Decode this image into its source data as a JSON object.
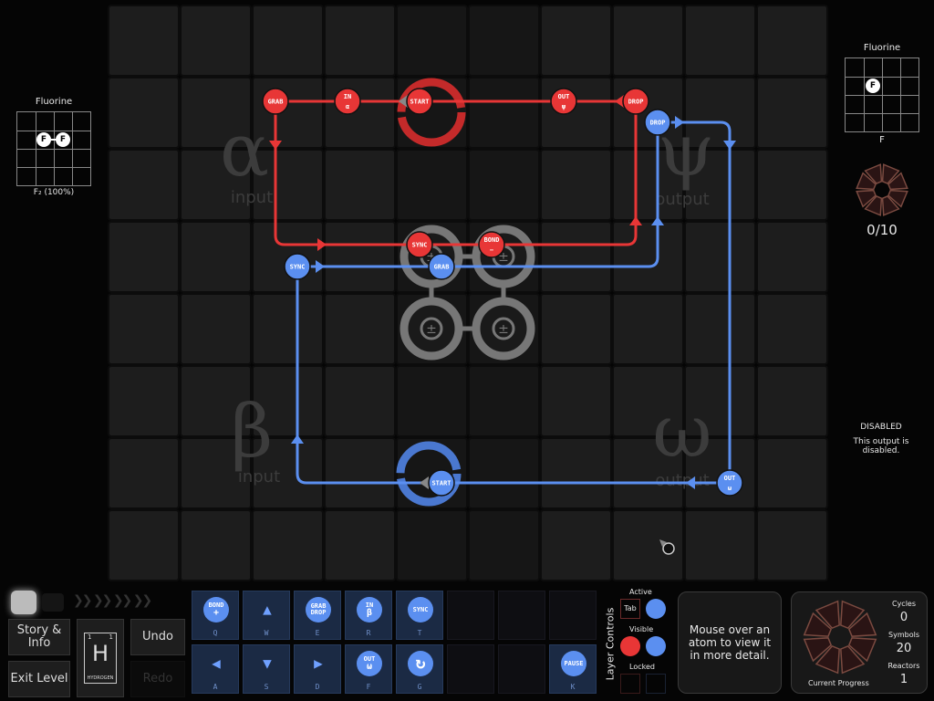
{
  "colors": {
    "red": "#e83636",
    "blue": "#5b8ff0",
    "gray": "#7a7a7a"
  },
  "inputs": [
    {
      "title": "Fluorine",
      "formula": "F₂ (100%)",
      "atoms": [
        "F",
        "F"
      ]
    }
  ],
  "outputs": [
    {
      "title": "Fluorine",
      "formula": "F",
      "atoms": [
        "F"
      ],
      "progress": "0/10"
    },
    {
      "status": "DISABLED",
      "message": "This output is disabled."
    }
  ],
  "reactor": {
    "zones": [
      {
        "symbol": "α",
        "label": "input"
      },
      {
        "symbol": "ψ",
        "label": "output"
      },
      {
        "symbol": "β",
        "label": "input"
      },
      {
        "symbol": "ω",
        "label": "output"
      }
    ],
    "red_instructions": [
      {
        "top": "GRAB"
      },
      {
        "top": "IN",
        "sub": "α"
      },
      {
        "top": "START"
      },
      {
        "top": "OUT",
        "sub": "ψ"
      },
      {
        "top": "DROP"
      },
      {
        "top": "SYNC"
      },
      {
        "top": "BOND",
        "sub": "−"
      }
    ],
    "blue_instructions": [
      {
        "top": "DROP"
      },
      {
        "top": "OUT",
        "sub": "ω"
      },
      {
        "top": "START"
      },
      {
        "top": "SYNC"
      },
      {
        "top": "GRAB"
      }
    ],
    "bonder_symbol": "±"
  },
  "controls": {
    "story": "Story & Info",
    "exit": "Exit Level",
    "undo": "Undo",
    "redo": "Redo",
    "element": {
      "symbol": "H",
      "number": "1",
      "mass": "1",
      "name": "HYDROGEN"
    }
  },
  "tools": [
    {
      "top": "BOND",
      "sub": "+",
      "key": "Q"
    },
    {
      "icon": "▲",
      "key": "W"
    },
    {
      "top": "GRAB",
      "sub": "DROP",
      "key": "E"
    },
    {
      "top": "IN",
      "sub": "β",
      "key": "R"
    },
    {
      "top": "SYNC",
      "key": "T"
    },
    {
      "icon": "◀",
      "key": "A"
    },
    {
      "icon": "▼",
      "key": "S"
    },
    {
      "icon": "▶",
      "key": "D"
    },
    {
      "top": "OUT",
      "sub": "ω",
      "key": "F"
    },
    {
      "top": "↻",
      "key": "G"
    },
    {
      "top": "PAUSE",
      "key": "K"
    }
  ],
  "layers": {
    "title": "Layer Controls",
    "active": "Active",
    "tab": "Tab",
    "visible": "Visible",
    "locked": "Locked"
  },
  "info": "Mouse over an atom to view it in more detail.",
  "stats": {
    "cycles_label": "Cycles",
    "cycles": "0",
    "symbols_label": "Symbols",
    "symbols": "20",
    "reactors_label": "Reactors",
    "reactors": "1",
    "progress_label": "Current Progress"
  }
}
